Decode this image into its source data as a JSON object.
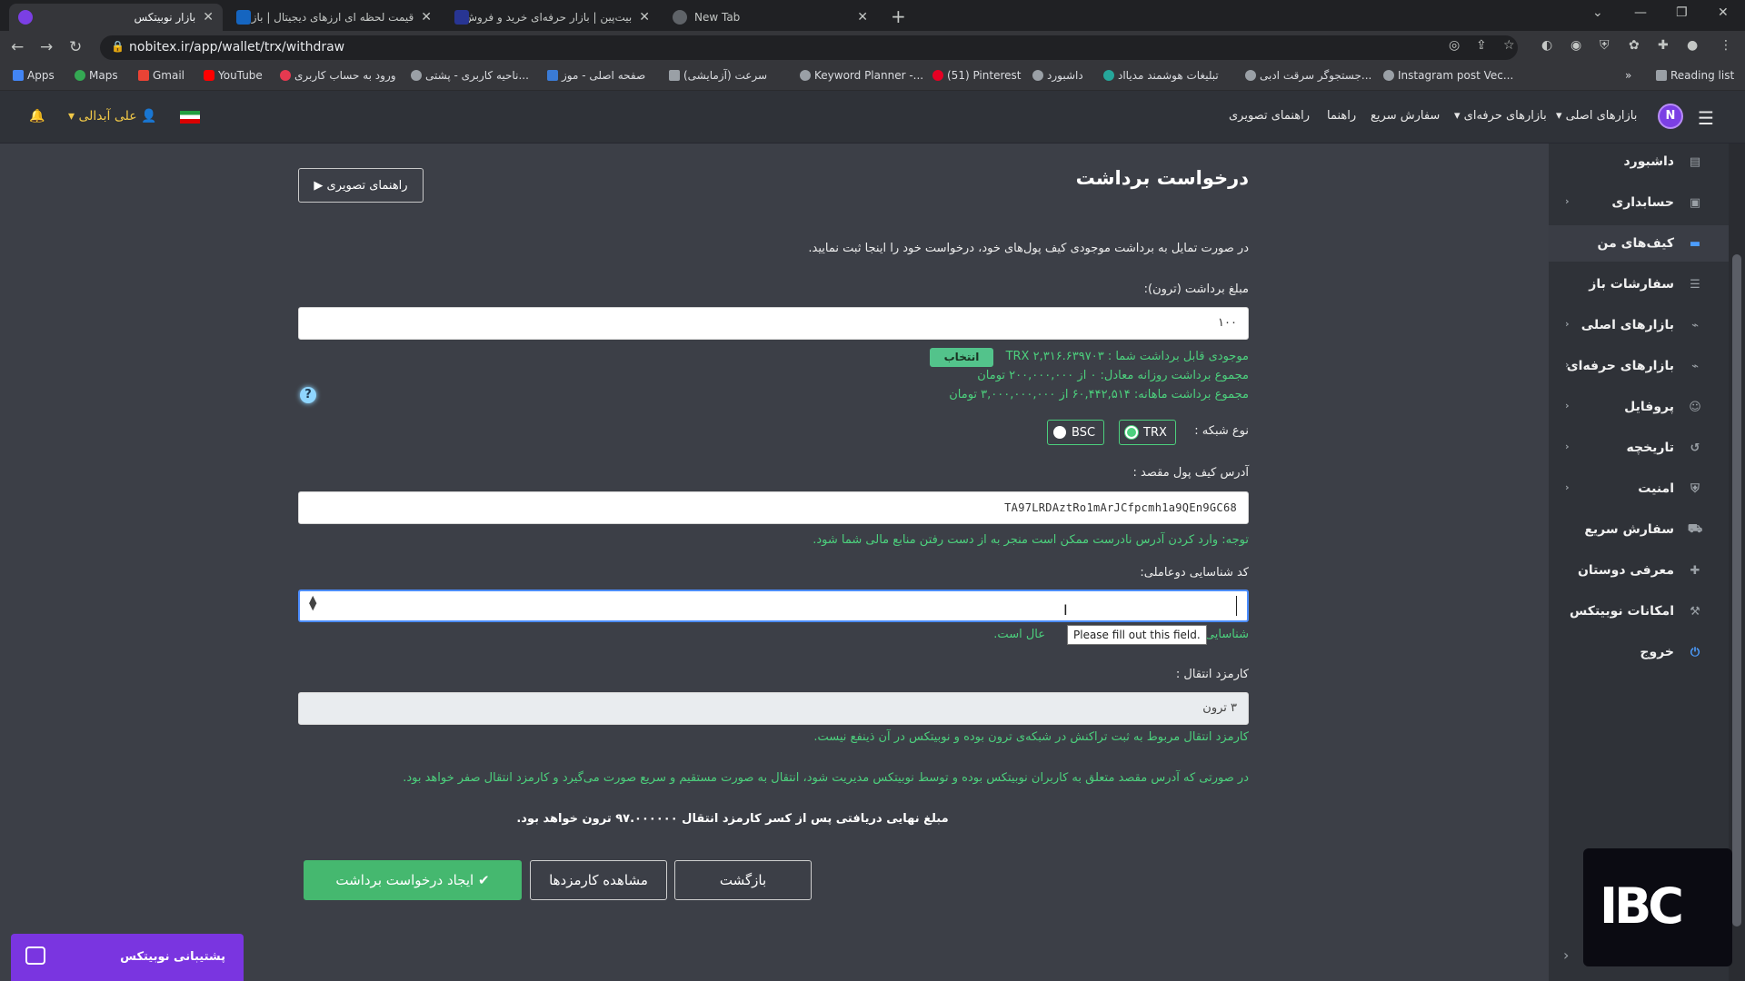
{
  "browser": {
    "tabs": [
      {
        "title": "بازار نوبیتکس",
        "active": true
      },
      {
        "title": "قیمت لحظه ای ارزهای دیجیتال | بازار",
        "active": false
      },
      {
        "title": "بیت‌پین | بازار حرفه‌ای خرید و فروش",
        "active": false
      },
      {
        "title": "New Tab",
        "active": false
      }
    ],
    "new_tab_symbol": "+",
    "url": "nobitex.ir/app/wallet/trx/withdraw",
    "bookmarks": [
      "Apps",
      "Maps",
      "Gmail",
      "YouTube",
      "ورود به حساب کاربری",
      "ناحیه کاربری - پشتی...",
      "صفحه اصلی - موز",
      "سرعت (آزمایشی)",
      "Keyword Planner -...",
      "(51) Pinterest",
      "داشبورد",
      "تبلیغات هوشمند مدیااد",
      "جستجوگر سرقت ادبی...",
      "Instagram post Vec..."
    ],
    "reading_list": "Reading list"
  },
  "header": {
    "nav": [
      "بازارهای اصلی",
      "بازارهای حرفه‌ای",
      "سفارش سریع",
      "راهنما",
      "راهنمای تصویری"
    ],
    "username": "علی آبدالی",
    "logo_letter": "N"
  },
  "sidebar": {
    "items": [
      {
        "label": "داشبورد",
        "icon": "clipboard-icon",
        "chevron": false,
        "active": false
      },
      {
        "label": "حسابداری",
        "icon": "check-clipboard-icon",
        "chevron": true,
        "active": false
      },
      {
        "label": "کیف‌های من",
        "icon": "wallet-icon",
        "chevron": false,
        "active": true
      },
      {
        "label": "سفارشات باز",
        "icon": "list-icon",
        "chevron": false,
        "active": false
      },
      {
        "label": "بازارهای اصلی",
        "icon": "chart-icon",
        "chevron": true,
        "active": false
      },
      {
        "label": "بازارهای حرفه‌ای",
        "icon": "chart-icon",
        "chevron": true,
        "active": false
      },
      {
        "label": "پروفایل",
        "icon": "user-gear-icon",
        "chevron": true,
        "active": false
      },
      {
        "label": "تاریخچه",
        "icon": "history-icon",
        "chevron": true,
        "active": false
      },
      {
        "label": "امنیت",
        "icon": "shield-icon",
        "chevron": true,
        "active": false
      },
      {
        "label": "سفارش سریع",
        "icon": "truck-icon",
        "chevron": false,
        "active": false
      },
      {
        "label": "معرفی دوستان",
        "icon": "user-plus-icon",
        "chevron": false,
        "active": false
      },
      {
        "label": "امکانات نوبیتکس",
        "icon": "tools-icon",
        "chevron": false,
        "active": false
      },
      {
        "label": "خروج",
        "icon": "power-icon",
        "chevron": false,
        "active": false
      }
    ]
  },
  "form": {
    "title": "درخواست برداشت",
    "guide_button": "راهنمای تصویری",
    "intro": "در صورت تمایل به برداشت موجودی کیف پول‌های خود، درخواست خود را اینجا ثبت نمایید.",
    "amount_label": "مبلغ برداشت (ترون):",
    "amount_value": "۱۰۰",
    "balance_text": "موجودی قابل برداشت شما : ۲,۳۱۶.۶۳۹۷۰۳ TRX",
    "select_button": "انتخاب",
    "daily_text": "مجموع برداشت روزانه معادل: ۰ از ۲۰۰,۰۰۰,۰۰۰ تومان",
    "monthly_text": "مجموع برداشت ماهانه: ۶۰,۴۴۲,۵۱۴ از ۳,۰۰۰,۰۰۰,۰۰۰ تومان",
    "help_symbol": "?",
    "network_label": "نوع شبکه :",
    "networks": [
      {
        "label": "TRX",
        "selected": true
      },
      {
        "label": "BSC",
        "selected": false
      }
    ],
    "address_label": "آدرس کیف پول مقصد :",
    "address_value": "TA97LRDAztRo1mArJCfpcmh1a9QEn9GC68",
    "address_warning": "توجه: وارد کردن آدرس نادرست ممکن است منجر به از دست رفتن منابع مالی شما شود.",
    "twofa_label": "کد شناسایی دوعاملی:",
    "twofa_value": "",
    "twofa_hint_start": "شناسایی دو",
    "twofa_hint_end": "عال است.",
    "tooltip": "Please fill out this field.",
    "fee_label": "کارمزد انتقال :",
    "fee_value": "۳ ترون",
    "fee_note": "کارمزد انتقال مربوط به ثبت تراکنش در شبکه‌ی ترون بوده و نوبیتکس در آن ذینفع نیست.",
    "internal_note": "در صورتی که آدرس مقصد متعلق به کاربران نوبیتکس بوده و توسط نوبیتکس مدیریت شود، انتقال به صورت مستقیم و سریع صورت می‌گیرد و کارمزد انتقال صفر خواهد بود.",
    "final_amount": "مبلغ نهایی دریافتی پس از کسر کارمزد انتقال ۹۷.۰۰۰۰۰۰ ترون خواهد بود.",
    "submit_button": "ایجاد درخواست برداشت",
    "fees_button": "مشاهده کارمزدها",
    "back_button": "بازگشت"
  },
  "support": {
    "label": "پشتیبانی نوبیتکس"
  },
  "watermark": {
    "text": "IBC"
  },
  "colors": {
    "accent_green": "#45b86f",
    "brand_purple": "#7a35e0",
    "username_yellow": "#f0c848"
  }
}
